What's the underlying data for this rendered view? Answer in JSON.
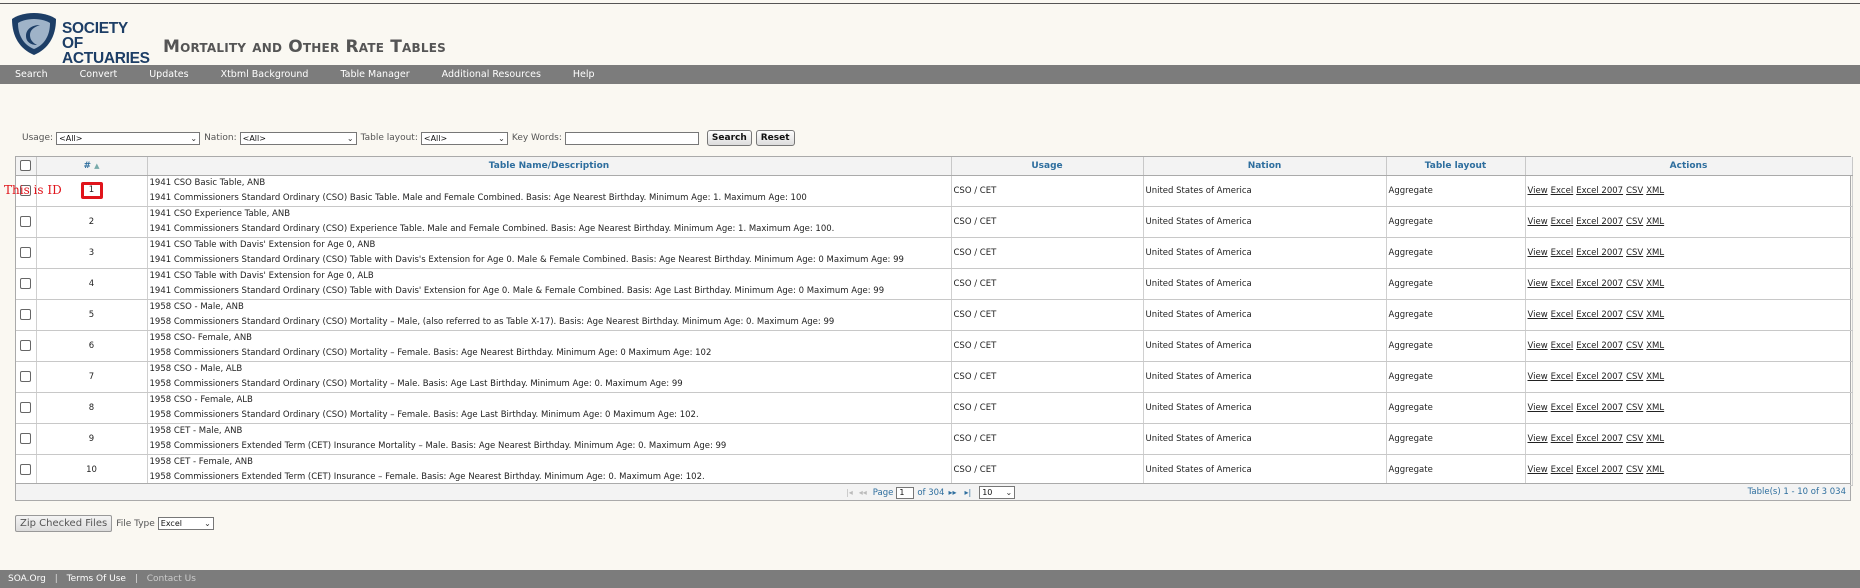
{
  "header": {
    "logo_line1": "SOCIETY OF",
    "logo_line2": "ACTUARIES",
    "page_title": "Mortality and Other Rate Tables"
  },
  "nav": [
    "Search",
    "Convert",
    "Updates",
    "Xtbml Background",
    "Table Manager",
    "Additional Resources",
    "Help"
  ],
  "filters": {
    "usage_label": "Usage:",
    "usage_value": "<All>",
    "nation_label": "Nation:",
    "nation_value": "<All>",
    "layout_label": "Table layout:",
    "layout_value": "<All>",
    "keywords_label": "Key Words:",
    "keywords_value": "",
    "search_label": "Search",
    "reset_label": "Reset"
  },
  "table": {
    "headers": {
      "id": "#",
      "name": "Table Name/Description",
      "usage": "CSO / CET",
      "usage_header": "Usage",
      "nation": "Nation",
      "layout": "Table layout",
      "actions": "Actions"
    },
    "action_labels": [
      "View",
      "Excel",
      "Excel 2007",
      "CSV",
      "XML"
    ],
    "rows": [
      {
        "id": "1",
        "title": "1941 CSO Basic Table, ANB",
        "desc": "1941 Commissioners Standard Ordinary (CSO) Basic Table. Male and Female Combined. Basis: Age Nearest Birthday. Minimum Age: 1. Maximum Age: 100",
        "usage": "CSO / CET",
        "nation": "United States of America",
        "layout": "Aggregate"
      },
      {
        "id": "2",
        "title": "1941 CSO Experience Table, ANB",
        "desc": "1941 Commissioners Standard Ordinary (CSO) Experience Table. Male and Female Combined. Basis: Age Nearest Birthday. Minimum Age: 1. Maximum Age: 100.",
        "usage": "CSO / CET",
        "nation": "United States of America",
        "layout": "Aggregate"
      },
      {
        "id": "3",
        "title": "1941 CSO Table with Davis' Extension for Age 0, ANB",
        "desc": "1941 Commissioners Standard Ordinary (CSO) Table with Davis's Extension for Age 0. Male & Female Combined. Basis: Age Nearest Birthday. Minimum Age: 0 Maximum Age: 99",
        "usage": "CSO / CET",
        "nation": "United States of America",
        "layout": "Aggregate"
      },
      {
        "id": "4",
        "title": "1941 CSO Table with Davis' Extension for Age 0, ALB",
        "desc": "1941 Commissioners Standard Ordinary (CSO) Table with Davis' Extension for Age 0. Male & Female Combined. Basis: Age Last Birthday. Minimum Age: 0 Maximum Age: 99",
        "usage": "CSO / CET",
        "nation": "United States of America",
        "layout": "Aggregate"
      },
      {
        "id": "5",
        "title": "1958 CSO - Male, ANB",
        "desc": "1958 Commissioners Standard Ordinary (CSO) Mortality – Male, (also referred to as Table X-17). Basis: Age Nearest Birthday. Minimum Age: 0. Maximum Age: 99",
        "usage": "CSO / CET",
        "nation": "United States of America",
        "layout": "Aggregate"
      },
      {
        "id": "6",
        "title": "1958 CSO- Female, ANB",
        "desc": "1958 Commissioners Standard Ordinary (CSO) Mortality – Female. Basis: Age Nearest Birthday. Minimum Age: 0 Maximum Age: 102",
        "usage": "CSO / CET",
        "nation": "United States of America",
        "layout": "Aggregate"
      },
      {
        "id": "7",
        "title": "1958 CSO - Male, ALB",
        "desc": "1958 Commissioners Standard Ordinary (CSO) Mortality – Male. Basis: Age Last Birthday. Minimum Age: 0. Maximum Age: 99",
        "usage": "CSO / CET",
        "nation": "United States of America",
        "layout": "Aggregate"
      },
      {
        "id": "8",
        "title": "1958 CSO - Female, ALB",
        "desc": "1958 Commissioners Standard Ordinary (CSO) Mortality – Female. Basis: Age Last Birthday. Minimum Age: 0 Maximum Age: 102.",
        "usage": "CSO / CET",
        "nation": "United States of America",
        "layout": "Aggregate"
      },
      {
        "id": "9",
        "title": "1958 CET - Male, ANB",
        "desc": "1958 Commissioners Extended Term (CET) Insurance Mortality – Male. Basis: Age Nearest Birthday. Minimum Age: 0. Maximum Age: 99",
        "usage": "CSO / CET",
        "nation": "United States of America",
        "layout": "Aggregate"
      },
      {
        "id": "10",
        "title": "1958 CET - Female, ANB",
        "desc": "1958 Commissioners Extended Term (CET) Insurance – Female. Basis: Age Nearest Birthday. Minimum Age: 0. Maximum Age: 102.",
        "usage": "CSO / CET",
        "nation": "United States of America",
        "layout": "Aggregate"
      }
    ]
  },
  "pager": {
    "page_label": "Page",
    "page_value": "1",
    "of_label": "of 304",
    "page_size": "10",
    "summary": "Table(s) 1 - 10 of 3 034"
  },
  "annotation": "This is ID",
  "zip": {
    "button_label": "Zip Checked Files",
    "file_type_label": "File Type",
    "file_type_value": "Excel"
  },
  "footer": {
    "link1": "SOA.Org",
    "link2": "Terms Of Use",
    "link3": "Contact Us"
  }
}
